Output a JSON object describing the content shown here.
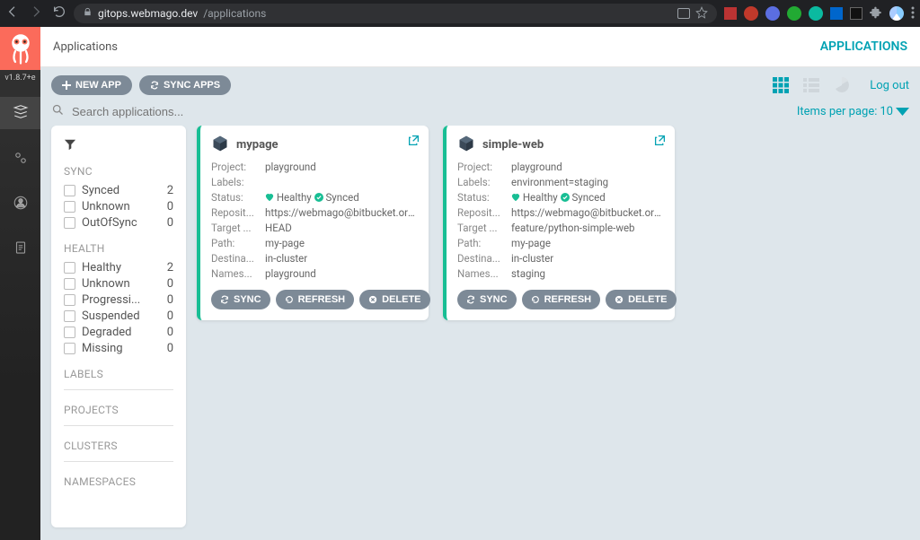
{
  "browser": {
    "url_host": "gitops.webmago.dev",
    "url_path": "/applications"
  },
  "version": "v1.8.7+e",
  "topbar": {
    "breadcrumb": "Applications",
    "apps_link": "APPLICATIONS"
  },
  "toolbar": {
    "new_app": "NEW APP",
    "sync_apps": "SYNC APPS",
    "logout": "Log out"
  },
  "search": {
    "placeholder": "Search applications..."
  },
  "items_per_page": {
    "label": "Items per page:",
    "value": "10"
  },
  "filters": {
    "sync": {
      "title": "SYNC",
      "items": [
        {
          "label": "Synced",
          "count": "2"
        },
        {
          "label": "Unknown",
          "count": "0"
        },
        {
          "label": "OutOfSync",
          "count": "0"
        }
      ]
    },
    "health": {
      "title": "HEALTH",
      "items": [
        {
          "label": "Healthy",
          "count": "2"
        },
        {
          "label": "Unknown",
          "count": "0"
        },
        {
          "label": "Progressi...",
          "count": "0"
        },
        {
          "label": "Suspended",
          "count": "0"
        },
        {
          "label": "Degraded",
          "count": "0"
        },
        {
          "label": "Missing",
          "count": "0"
        }
      ]
    },
    "labels_title": "LABELS",
    "projects_title": "PROJECTS",
    "clusters_title": "CLUSTERS",
    "namespaces_title": "NAMESPACES"
  },
  "field_labels": {
    "project": "Project:",
    "labels": "Labels:",
    "status": "Status:",
    "repo": "Reposit...",
    "target": "Target ...",
    "path": "Path:",
    "dest": "Destina...",
    "ns": "Names..."
  },
  "status_labels": {
    "healthy": "Healthy",
    "synced": "Synced"
  },
  "card_actions": {
    "sync": "SYNC",
    "refresh": "REFRESH",
    "delete": "DELETE"
  },
  "apps": [
    {
      "name": "mypage",
      "project": "playground",
      "labels": "",
      "repo": "https://webmago@bitbucket.org/we...",
      "target": "HEAD",
      "path": "my-page",
      "dest": "in-cluster",
      "ns": "playground"
    },
    {
      "name": "simple-web",
      "project": "playground",
      "labels": "environment=staging",
      "repo": "https://webmago@bitbucket.org/we...",
      "target": "feature/python-simple-web",
      "path": "my-page",
      "dest": "in-cluster",
      "ns": "staging"
    }
  ]
}
